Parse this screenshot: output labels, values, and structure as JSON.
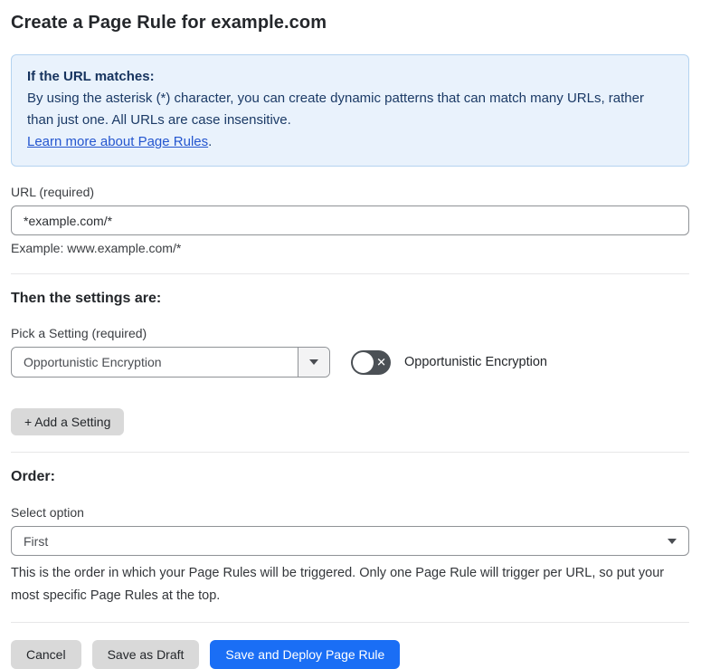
{
  "page": {
    "title": "Create a Page Rule for example.com"
  },
  "info_box": {
    "heading": "If the URL matches:",
    "body": "By using the asterisk (*) character, you can create dynamic patterns that can match many URLs, rather than just one. All URLs are case insensitive.",
    "link_label": "Learn more about Page Rules",
    "link_suffix": "."
  },
  "url_field": {
    "label": "URL (required)",
    "value": "*example.com/*",
    "helper": "Example: www.example.com/*"
  },
  "settings_section": {
    "heading": "Then the settings are:",
    "picker_label": "Pick a Setting (required)",
    "selected_setting": "Opportunistic Encryption",
    "toggle_label": "Opportunistic Encryption",
    "toggle_state": "off",
    "add_setting_label": "+ Add a Setting"
  },
  "order_section": {
    "heading": "Order:",
    "select_label": "Select option",
    "selected_option": "First",
    "helper": "This is the order in which your Page Rules will be triggered. Only one Page Rule will trigger per URL, so put your most specific Page Rules at the top."
  },
  "actions": {
    "cancel_label": "Cancel",
    "save_draft_label": "Save as Draft",
    "save_deploy_label": "Save and Deploy Page Rule"
  },
  "colors": {
    "info_background": "#e9f2fc",
    "info_border": "#b4d3f0",
    "info_text": "#1b3a66",
    "link": "#2456cf",
    "primary_button": "#1a6ef5",
    "gray_button": "#d9d9d9",
    "toggle_off": "#4b5055"
  }
}
